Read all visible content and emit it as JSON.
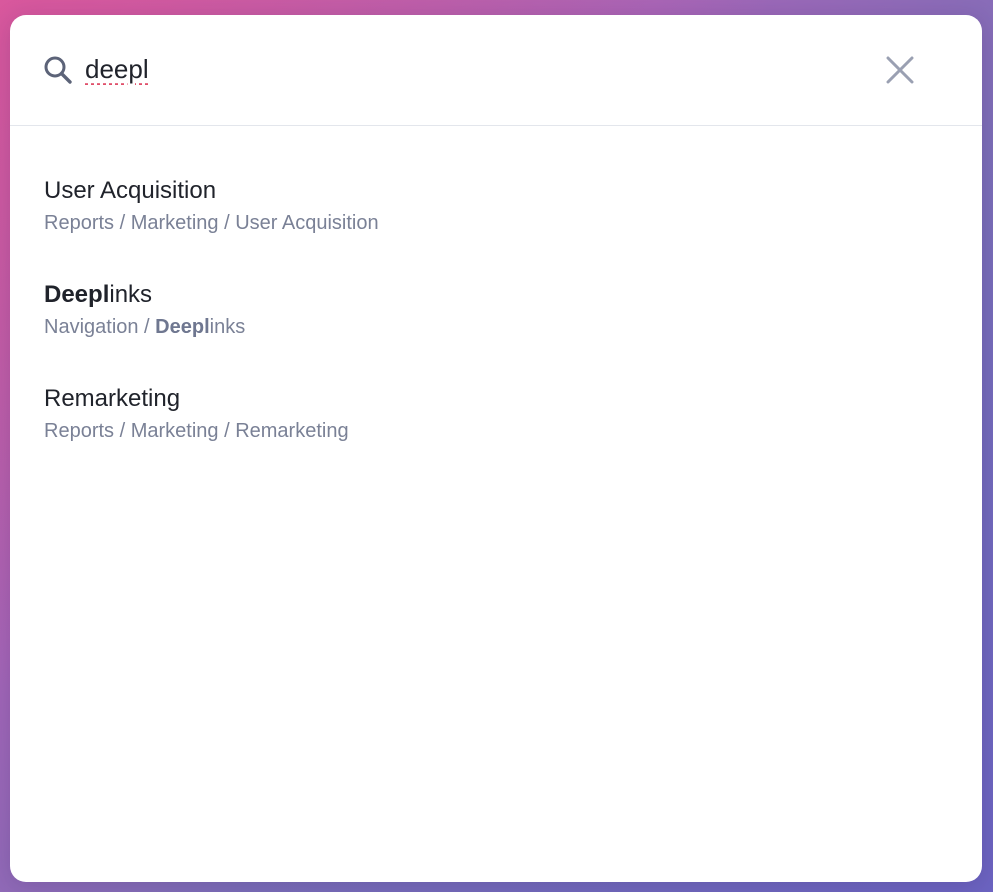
{
  "search": {
    "value": "deepl",
    "icon": "search-icon",
    "close_icon": "close-icon"
  },
  "results": [
    {
      "title_match": "",
      "title_rest": "User Acquisition",
      "path_prefix": "Reports / Marketing / ",
      "path_match": "",
      "path_rest": "User Acquisition"
    },
    {
      "title_match": "Deepl",
      "title_rest": "inks",
      "path_prefix": "Navigation / ",
      "path_match": "Deepl",
      "path_rest": "inks"
    },
    {
      "title_match": "",
      "title_rest": "Remarketing",
      "path_prefix": "Reports / Marketing / ",
      "path_match": "",
      "path_rest": "Remarketing"
    }
  ],
  "colors": {
    "title": "#20232b",
    "path": "#7a8196",
    "icon": "#9aa0b2",
    "divider": "#e3e6ec",
    "spellcheck": "#e0506a"
  }
}
